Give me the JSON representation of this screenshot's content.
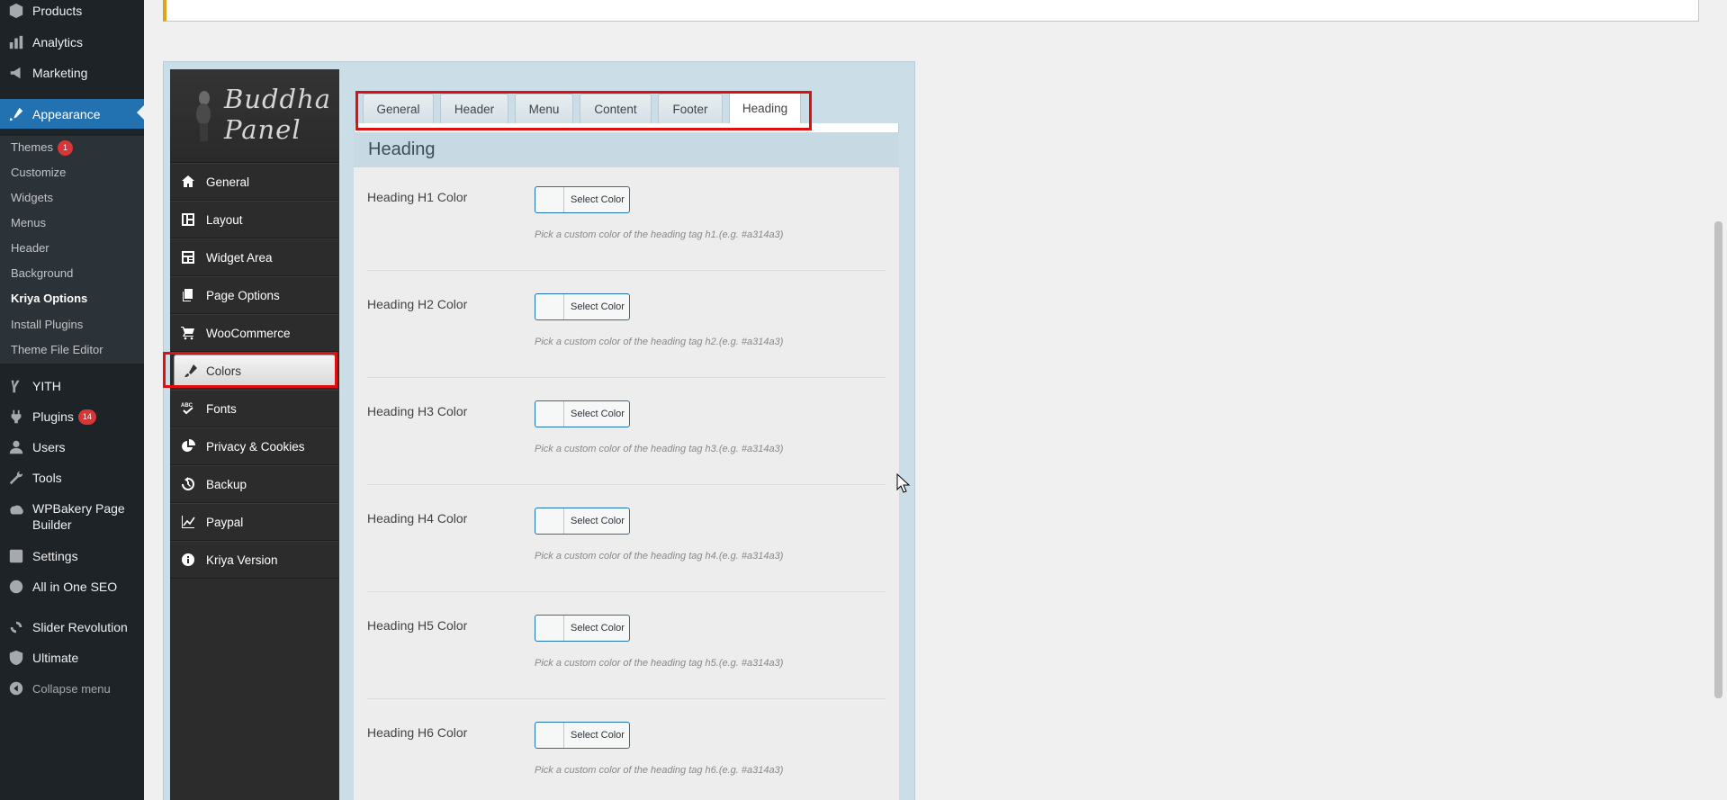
{
  "admin_menu": {
    "items": [
      {
        "label": "Products",
        "icon": "products-icon"
      },
      {
        "label": "Analytics",
        "icon": "analytics-icon"
      },
      {
        "label": "Marketing",
        "icon": "marketing-icon"
      },
      {
        "label": "Appearance",
        "icon": "appearance-icon"
      },
      {
        "label": "YITH",
        "icon": "yith-icon"
      },
      {
        "label": "Plugins",
        "icon": "plugins-icon",
        "badge": "14"
      },
      {
        "label": "Users",
        "icon": "users-icon"
      },
      {
        "label": "Tools",
        "icon": "tools-icon"
      },
      {
        "label": "WPBakery Page",
        "label2": "Builder",
        "icon": "wpbakery-icon"
      },
      {
        "label": "Settings",
        "icon": "settings-icon"
      },
      {
        "label": "All in One SEO",
        "icon": "seo-icon"
      },
      {
        "label": "Slider Revolution",
        "icon": "slider-icon"
      },
      {
        "label": "Ultimate",
        "icon": "ultimate-icon"
      },
      {
        "label": "Collapse menu",
        "icon": "collapse-icon"
      }
    ],
    "submenu": [
      {
        "label": "Themes",
        "badge": "1"
      },
      {
        "label": "Customize"
      },
      {
        "label": "Widgets"
      },
      {
        "label": "Menus"
      },
      {
        "label": "Header"
      },
      {
        "label": "Background"
      },
      {
        "label": "Kriya Options"
      },
      {
        "label": "Install Plugins"
      },
      {
        "label": "Theme File Editor"
      }
    ]
  },
  "panel": {
    "logo_line1": "Buddha",
    "logo_line2": "Panel",
    "nav": [
      {
        "label": "General",
        "icon": "home-icon"
      },
      {
        "label": "Layout",
        "icon": "layout-icon"
      },
      {
        "label": "Widget Area",
        "icon": "widget-icon"
      },
      {
        "label": "Page Options",
        "icon": "pages-icon"
      },
      {
        "label": "WooCommerce",
        "icon": "cart-icon"
      },
      {
        "label": "Colors",
        "icon": "brush-icon"
      },
      {
        "label": "Fonts",
        "icon": "fonts-icon"
      },
      {
        "label": "Privacy & Cookies",
        "icon": "pie-icon"
      },
      {
        "label": "Backup",
        "icon": "backup-icon"
      },
      {
        "label": "Paypal",
        "icon": "chart-icon"
      },
      {
        "label": "Kriya Version",
        "icon": "info-icon"
      }
    ],
    "tabs": [
      "General",
      "Header",
      "Menu",
      "Content",
      "Footer",
      "Heading"
    ],
    "section_title": "Heading",
    "rows": [
      {
        "label": "Heading H1 Color",
        "button": "Select Color",
        "desc": "Pick a custom color of the heading tag h1.(e.g. #a314a3)"
      },
      {
        "label": "Heading H2 Color",
        "button": "Select Color",
        "desc": "Pick a custom color of the heading tag h2.(e.g. #a314a3)"
      },
      {
        "label": "Heading H3 Color",
        "button": "Select Color",
        "desc": "Pick a custom color of the heading tag h3.(e.g. #a314a3)"
      },
      {
        "label": "Heading H4 Color",
        "button": "Select Color",
        "desc": "Pick a custom color of the heading tag h4.(e.g. #a314a3)"
      },
      {
        "label": "Heading H5 Color",
        "button": "Select Color",
        "desc": "Pick a custom color of the heading tag h5.(e.g. #a314a3)"
      },
      {
        "label": "Heading H6 Color",
        "button": "Select Color",
        "desc": "Pick a custom color of the heading tag h6.(e.g. #a314a3)"
      }
    ]
  },
  "colors": {
    "admin_bg": "#1d2327",
    "accent": "#2271b1",
    "highlight": "#dd1111"
  }
}
